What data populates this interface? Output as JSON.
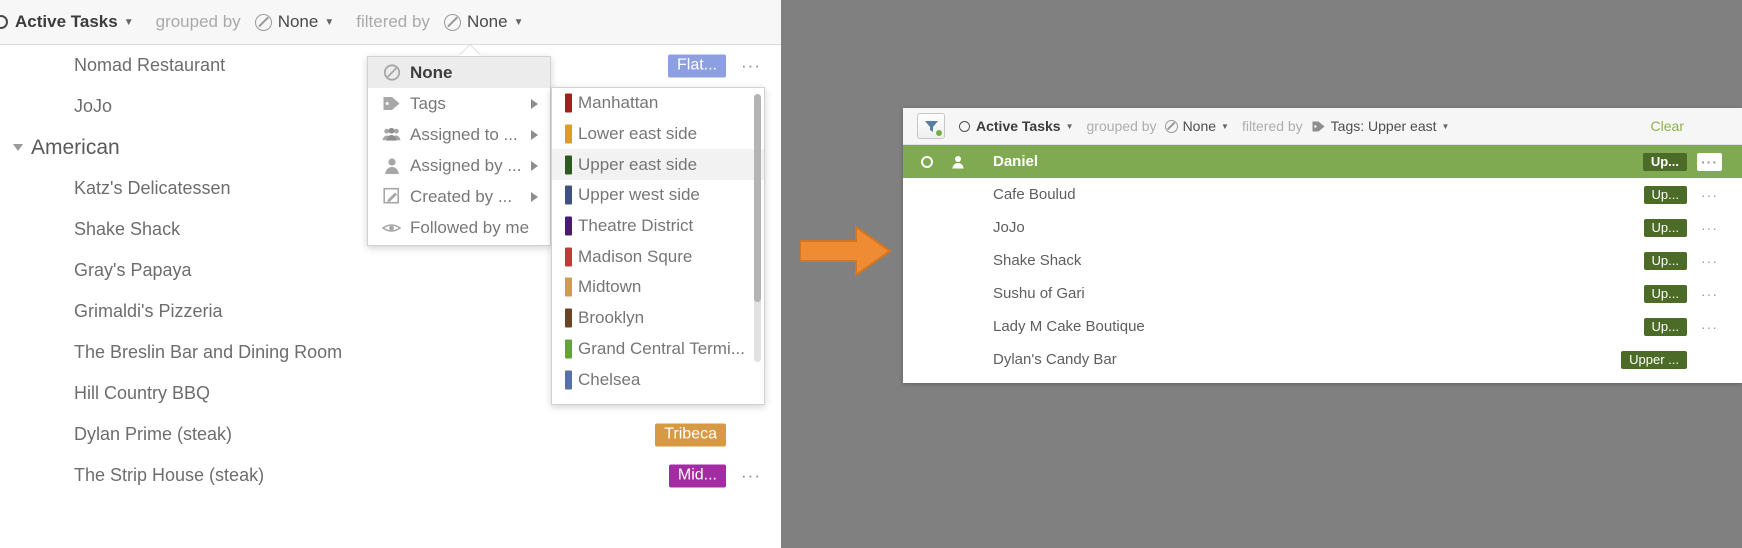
{
  "left": {
    "toolbar": {
      "view_label": "Active Tasks",
      "grouped_by_label": "grouped by",
      "group_value": "None",
      "filtered_by_label": "filtered by",
      "filter_value": "None"
    },
    "rows": [
      {
        "label": "Nomad Restaurant",
        "group": false,
        "badge": "Flat...",
        "badge_color": "#8c9fe0",
        "dots": "···"
      },
      {
        "label": "JoJo",
        "group": false,
        "badge": "",
        "badge_color": "",
        "dots": ""
      },
      {
        "label": "American",
        "group": true,
        "badge": "",
        "badge_color": "",
        "dots": ""
      },
      {
        "label": "Katz's Delicatessen",
        "group": false,
        "badge": "",
        "badge_color": "",
        "dots": ""
      },
      {
        "label": "Shake Shack",
        "group": false,
        "badge": "",
        "badge_color": "",
        "dots": ""
      },
      {
        "label": "Gray's Papaya",
        "group": false,
        "badge": "",
        "badge_color": "",
        "dots": ""
      },
      {
        "label": "Grimaldi's Pizzeria",
        "group": false,
        "badge": "",
        "badge_color": "",
        "dots": ""
      },
      {
        "label": "The Breslin Bar and Dining Room",
        "group": false,
        "badge": "",
        "badge_color": "",
        "dots": ""
      },
      {
        "label": "Hill Country BBQ",
        "group": false,
        "badge": "",
        "badge_color": "",
        "dots": ""
      },
      {
        "label": "Dylan Prime (steak)",
        "group": false,
        "badge": "Tribeca",
        "badge_color": "#d79944",
        "dots": ""
      },
      {
        "label": "The Strip House (steak)",
        "group": false,
        "badge": "Mid...",
        "badge_color": "#a32ca3",
        "dots": "···"
      }
    ]
  },
  "menu": {
    "items": [
      {
        "label": "None",
        "icon": "circle-slash-icon",
        "selected": true,
        "submenu": false
      },
      {
        "label": "Tags",
        "icon": "tag-icon",
        "selected": false,
        "submenu": true
      },
      {
        "label": "Assigned to ...",
        "icon": "group-icon",
        "selected": false,
        "submenu": true
      },
      {
        "label": "Assigned by ...",
        "icon": "person-icon",
        "selected": false,
        "submenu": true
      },
      {
        "label": "Created by ...",
        "icon": "pencil-square-icon",
        "selected": false,
        "submenu": true
      },
      {
        "label": "Followed by me",
        "icon": "eye-icon",
        "selected": false,
        "submenu": false
      }
    ]
  },
  "submenu": {
    "tags": [
      {
        "label": "Manhattan",
        "color": "#a31f1f",
        "selected": false
      },
      {
        "label": "Lower east side",
        "color": "#e09b25",
        "selected": false
      },
      {
        "label": "Upper east side",
        "color": "#2d5a1e",
        "selected": true
      },
      {
        "label": "Upper west side",
        "color": "#3e5180",
        "selected": false
      },
      {
        "label": "Theatre District",
        "color": "#4b1a6e",
        "selected": false
      },
      {
        "label": "Madison Squre",
        "color": "#c43838",
        "selected": false
      },
      {
        "label": "Midtown",
        "color": "#cd9e4b",
        "selected": false
      },
      {
        "label": "Brooklyn",
        "color": "#6b4523",
        "selected": false
      },
      {
        "label": "Grand Central Termi...",
        "color": "#63a33a",
        "selected": false
      },
      {
        "label": "Chelsea",
        "color": "#5770a8",
        "selected": false
      }
    ]
  },
  "right": {
    "toolbar": {
      "filter_icon": "funnel-icon",
      "view_label": "Active Tasks",
      "grouped_by_label": "grouped by",
      "group_value": "None",
      "filtered_by_label": "filtered by",
      "filter_value": "Tags: Upper east",
      "clear_label": "Clear"
    },
    "rows": [
      {
        "label": "Daniel",
        "highlight": true,
        "badge": "Up...",
        "dots": "···"
      },
      {
        "label": "Cafe Boulud",
        "highlight": false,
        "badge": "Up...",
        "dots": "···"
      },
      {
        "label": "JoJo",
        "highlight": false,
        "badge": "Up...",
        "dots": "···"
      },
      {
        "label": "Shake Shack",
        "highlight": false,
        "badge": "Up...",
        "dots": "···"
      },
      {
        "label": "Sushu of Gari",
        "highlight": false,
        "badge": "Up...",
        "dots": "···"
      },
      {
        "label": "Lady M Cake Boutique",
        "highlight": false,
        "badge": "Up...",
        "dots": "···"
      },
      {
        "label": "Dylan's Candy Bar",
        "highlight": false,
        "badge": "Upper ...",
        "dots": ""
      }
    ]
  },
  "colors": {
    "highlight_green": "#80aa51",
    "badge_dark_green": "#4b6b26",
    "arrow_orange": "#ef8b33",
    "backdrop_gray": "#808080"
  }
}
